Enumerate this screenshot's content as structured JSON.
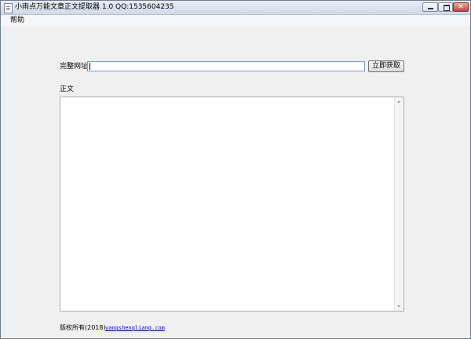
{
  "window": {
    "title": "小雨点万能文章正文提取器 1.0   QQ:1535604235",
    "icon": "document-icon"
  },
  "menu": {
    "help_label": "帮助"
  },
  "form": {
    "url_label": "完整网址",
    "url_value": "",
    "fetch_button_label": "立即获取",
    "body_label": "正文",
    "body_value": ""
  },
  "footer": {
    "copyright": "版权所有(2018)",
    "link_text": "yangshengliang.com"
  }
}
